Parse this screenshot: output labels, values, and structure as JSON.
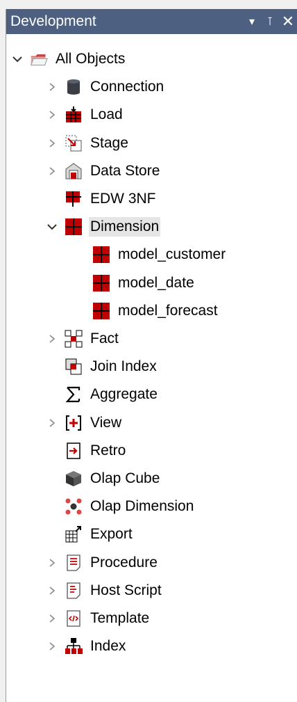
{
  "panel": {
    "title": "Development",
    "controls": {
      "dropdown": "▾",
      "pin": "⊺",
      "close": "✕"
    },
    "accent": "#4d6082"
  },
  "tree": [
    {
      "label": "All Objects",
      "icon": "folder-open-icon",
      "expander": "open"
    },
    {
      "label": "Connection",
      "icon": "database-icon",
      "expander": "closed"
    },
    {
      "label": "Load",
      "icon": "load-table-icon",
      "expander": "closed"
    },
    {
      "label": "Stage",
      "icon": "stage-table-icon",
      "expander": "closed"
    },
    {
      "label": "Data Store",
      "icon": "data-store-icon",
      "expander": "closed"
    },
    {
      "label": "EDW 3NF",
      "icon": "edw-table-icon",
      "expander": "none"
    },
    {
      "label": "Dimension",
      "icon": "dimension-icon",
      "expander": "open",
      "selected": true
    },
    {
      "label": "model_customer",
      "icon": "dimension-icon",
      "expander": "none"
    },
    {
      "label": "model_date",
      "icon": "dimension-icon",
      "expander": "none"
    },
    {
      "label": "model_forecast",
      "icon": "dimension-icon",
      "expander": "none"
    },
    {
      "label": "Fact",
      "icon": "fact-icon",
      "expander": "closed"
    },
    {
      "label": "Join Index",
      "icon": "join-index-icon",
      "expander": "none"
    },
    {
      "label": "Aggregate",
      "icon": "sigma-icon",
      "expander": "none"
    },
    {
      "label": "View",
      "icon": "view-icon",
      "expander": "closed"
    },
    {
      "label": "Retro",
      "icon": "retro-icon",
      "expander": "none"
    },
    {
      "label": "Olap Cube",
      "icon": "cube-icon",
      "expander": "none"
    },
    {
      "label": "Olap Dimension",
      "icon": "olap-dimension-icon",
      "expander": "none"
    },
    {
      "label": "Export",
      "icon": "export-icon",
      "expander": "none"
    },
    {
      "label": "Procedure",
      "icon": "procedure-icon",
      "expander": "closed"
    },
    {
      "label": "Host Script",
      "icon": "script-icon",
      "expander": "closed"
    },
    {
      "label": "Template",
      "icon": "template-icon",
      "expander": "closed"
    },
    {
      "label": "Index",
      "icon": "index-icon",
      "expander": "closed"
    }
  ]
}
